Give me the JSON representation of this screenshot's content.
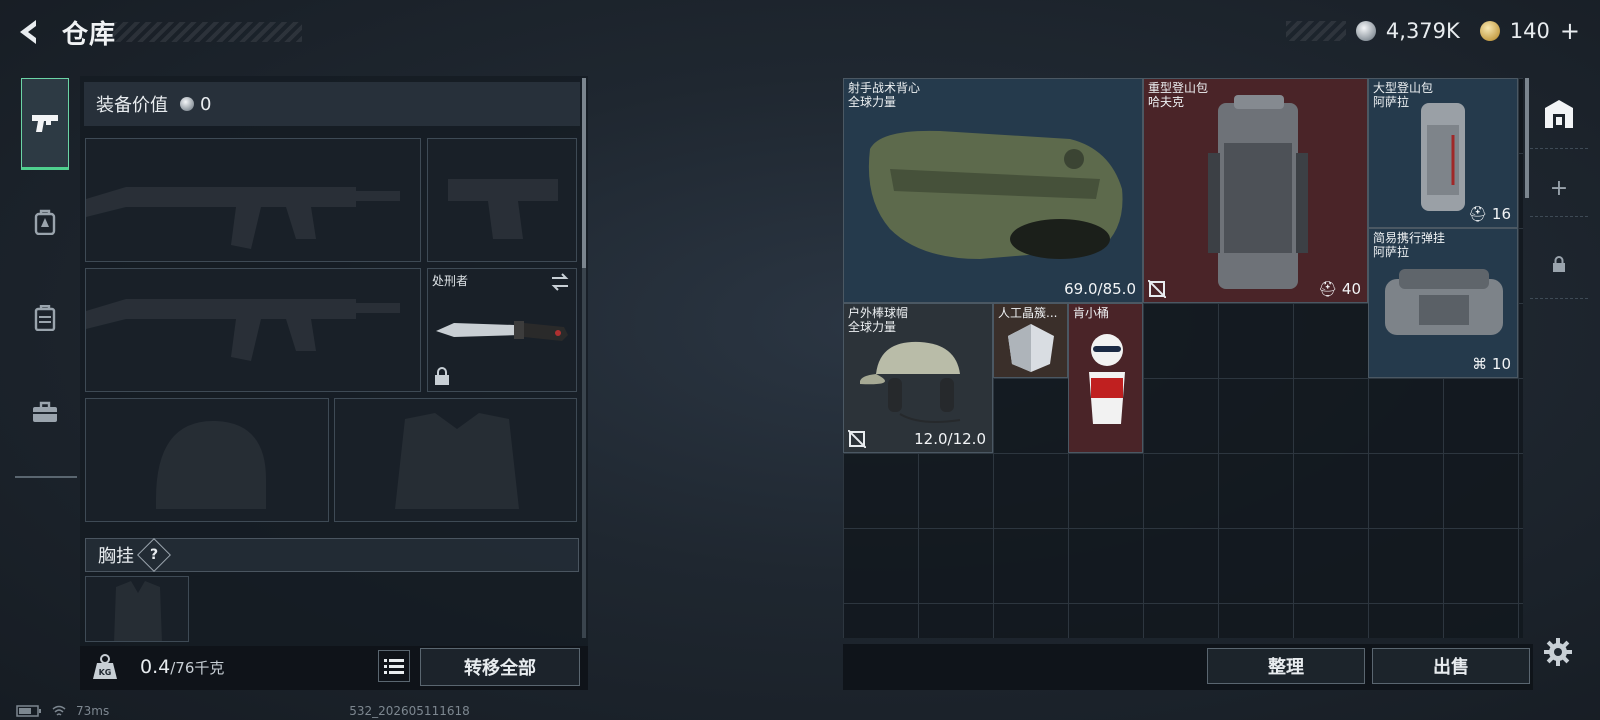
{
  "header": {
    "title": "仓库"
  },
  "currency": {
    "silver": "4,379K",
    "gold": "140",
    "gold_plus": "+"
  },
  "nav": {
    "items": [
      "pistol-icon",
      "backpack-icon",
      "vest-icon",
      "case-icon"
    ],
    "active": 0
  },
  "equipment": {
    "value_label": "装备价值",
    "value": "0",
    "melee_slot_label": "处刑者",
    "chest_rig_label": "胸挂",
    "chest_rig_help": "?"
  },
  "weight": {
    "current": "0.4",
    "max": "/76千克"
  },
  "buttons": {
    "transfer_all": "转移全部",
    "sort": "整理",
    "sell": "出售"
  },
  "stash": {
    "items": [
      {
        "name": "射手战术背心",
        "sub": "全球力量",
        "value": "69.0/85.0",
        "color": "blue"
      },
      {
        "name": "重型登山包",
        "sub": "哈夫克",
        "value": "40",
        "color": "red"
      },
      {
        "name": "大型登山包",
        "sub": "阿萨拉",
        "value": "16",
        "color": "blue"
      },
      {
        "name": "简易携行弹挂",
        "sub": "阿萨拉",
        "value": "10",
        "color": "blue"
      },
      {
        "name": "户外棒球帽",
        "sub": "全球力量",
        "value": "12.0/12.0",
        "color": "gray"
      },
      {
        "name": "人工晶簇...",
        "sub": "",
        "value": "",
        "color": "brown"
      },
      {
        "name": "肯小桶",
        "sub": "",
        "value": "",
        "color": "red"
      }
    ]
  },
  "status": {
    "ping": "73ms",
    "build": "532_202605111618"
  }
}
